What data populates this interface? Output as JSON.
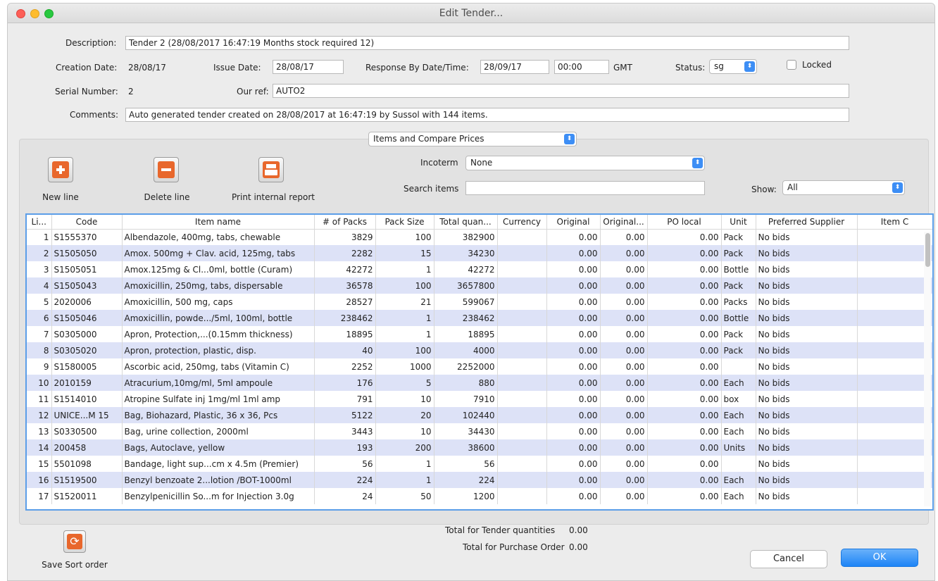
{
  "window": {
    "title": "Edit Tender..."
  },
  "form": {
    "description_label": "Description:",
    "description_value": "Tender 2 (28/08/2017 16:47:19 Months stock required 12)",
    "creation_date_label": "Creation Date:",
    "creation_date_value": "28/08/17",
    "issue_date_label": "Issue Date:",
    "issue_date_value": "28/08/17",
    "response_label": "Response By Date/Time:",
    "response_date_value": "28/09/17",
    "response_time_value": "00:00",
    "timezone": "GMT",
    "status_label": "Status:",
    "status_value": "sg",
    "locked_label": "Locked",
    "serial_label": "Serial Number:",
    "serial_value": "2",
    "our_ref_label": "Our ref:",
    "our_ref_value": "AUTO2",
    "comments_label": "Comments:",
    "comments_value": "Auto generated tender created on 28/08/2017 at 16:47:19 by Sussol with 144 items."
  },
  "panel": {
    "view_select": "Items and Compare Prices",
    "incoterm_label": "Incoterm",
    "incoterm_value": "None",
    "search_label": "Search items",
    "search_value": "",
    "show_label": "Show:",
    "show_value": "All",
    "new_line_label": "New line",
    "delete_line_label": "Delete line",
    "print_label": "Print internal report"
  },
  "table": {
    "columns": [
      "Li...",
      "Code",
      "Item name",
      "# of Packs",
      "Pack Size",
      "Total quan...",
      "Currency",
      "Original",
      "Original...",
      "PO local",
      "Unit",
      "Preferred Supplier",
      "Item C"
    ],
    "rows": [
      [
        "1",
        "S1555370",
        "Albendazole, 400mg, tabs, chewable",
        "3829",
        "100",
        "382900",
        "",
        "0.00",
        "0.00",
        "0.00",
        "Pack",
        "No bids",
        ""
      ],
      [
        "2",
        "S1505050",
        "Amox. 500mg + Clav. acid, 125mg, tabs",
        "2282",
        "15",
        "34230",
        "",
        "0.00",
        "0.00",
        "0.00",
        "Pack",
        "No bids",
        ""
      ],
      [
        "3",
        "S1505051",
        "Amox.125mg & Cl...0ml, bottle (Curam)",
        "42272",
        "1",
        "42272",
        "",
        "0.00",
        "0.00",
        "0.00",
        "Bottle",
        "No bids",
        ""
      ],
      [
        "4",
        "S1505043",
        "Amoxicillin, 250mg, tabs, dispersable",
        "36578",
        "100",
        "3657800",
        "",
        "0.00",
        "0.00",
        "0.00",
        "Pack",
        "No bids",
        ""
      ],
      [
        "5",
        "2020006",
        "Amoxicillin, 500 mg, caps",
        "28527",
        "21",
        "599067",
        "",
        "0.00",
        "0.00",
        "0.00",
        "Packs",
        "No bids",
        ""
      ],
      [
        "6",
        "S1505046",
        "Amoxicillin, powde.../5ml, 100ml, bottle",
        "238462",
        "1",
        "238462",
        "",
        "0.00",
        "0.00",
        "0.00",
        "Bottle",
        "No bids",
        ""
      ],
      [
        "7",
        "S0305000",
        "Apron, Protection,...(0.15mm thickness)",
        "18895",
        "1",
        "18895",
        "",
        "0.00",
        "0.00",
        "0.00",
        "Pack",
        "No bids",
        ""
      ],
      [
        "8",
        "S0305020",
        "Apron, protection, plastic, disp.",
        "40",
        "100",
        "4000",
        "",
        "0.00",
        "0.00",
        "0.00",
        "Pack",
        "No bids",
        ""
      ],
      [
        "9",
        "S1580005",
        "Ascorbic acid, 250mg, tabs (Vitamin C)",
        "2252",
        "1000",
        "2252000",
        "",
        "0.00",
        "0.00",
        "0.00",
        "",
        "No bids",
        ""
      ],
      [
        "10",
        "2010159",
        "Atracurium,10mg/ml, 5ml ampoule",
        "176",
        "5",
        "880",
        "",
        "0.00",
        "0.00",
        "0.00",
        "Each",
        "No bids",
        ""
      ],
      [
        "11",
        "S1514010",
        "Atropine Sulfate inj 1mg/ml 1ml amp",
        "791",
        "10",
        "7910",
        "",
        "0.00",
        "0.00",
        "0.00",
        "box",
        "No bids",
        ""
      ],
      [
        "12",
        "UNICE...M 15",
        "Bag, Biohazard, Plastic, 36 x 36, Pcs",
        "5122",
        "20",
        "102440",
        "",
        "0.00",
        "0.00",
        "0.00",
        "Each",
        "No bids",
        ""
      ],
      [
        "13",
        "S0330500",
        "Bag, urine collection, 2000ml",
        "3443",
        "10",
        "34430",
        "",
        "0.00",
        "0.00",
        "0.00",
        "Each",
        "No bids",
        ""
      ],
      [
        "14",
        "200458",
        "Bags, Autoclave, yellow",
        "193",
        "200",
        "38600",
        "",
        "0.00",
        "0.00",
        "0.00",
        "Units",
        "No bids",
        ""
      ],
      [
        "15",
        "5501098",
        "Bandage, light sup...cm x 4.5m (Premier)",
        "56",
        "1",
        "56",
        "",
        "0.00",
        "0.00",
        "0.00",
        "",
        "No bids",
        ""
      ],
      [
        "16",
        "S1519500",
        "Benzyl benzoate 2...lotion /BOT-1000ml",
        "224",
        "1",
        "224",
        "",
        "0.00",
        "0.00",
        "0.00",
        "Each",
        "No bids",
        ""
      ],
      [
        "17",
        "S1520011",
        "Benzylpenicillin So...m for Injection 3.0g",
        "24",
        "50",
        "1200",
        "",
        "0.00",
        "0.00",
        "0.00",
        "Each",
        "No bids",
        ""
      ]
    ]
  },
  "footer": {
    "save_sort_label": "Save Sort order",
    "total_tender_label": "Total for Tender quantities",
    "total_tender_value": "0.00",
    "total_po_label": "Total for Purchase Order",
    "total_po_value": "0.00",
    "cancel_label": "Cancel",
    "ok_label": "OK"
  },
  "colors": {
    "accent": "#1d84f6",
    "row_alt": "#dde2f7",
    "add_icon": "#e8672c"
  }
}
